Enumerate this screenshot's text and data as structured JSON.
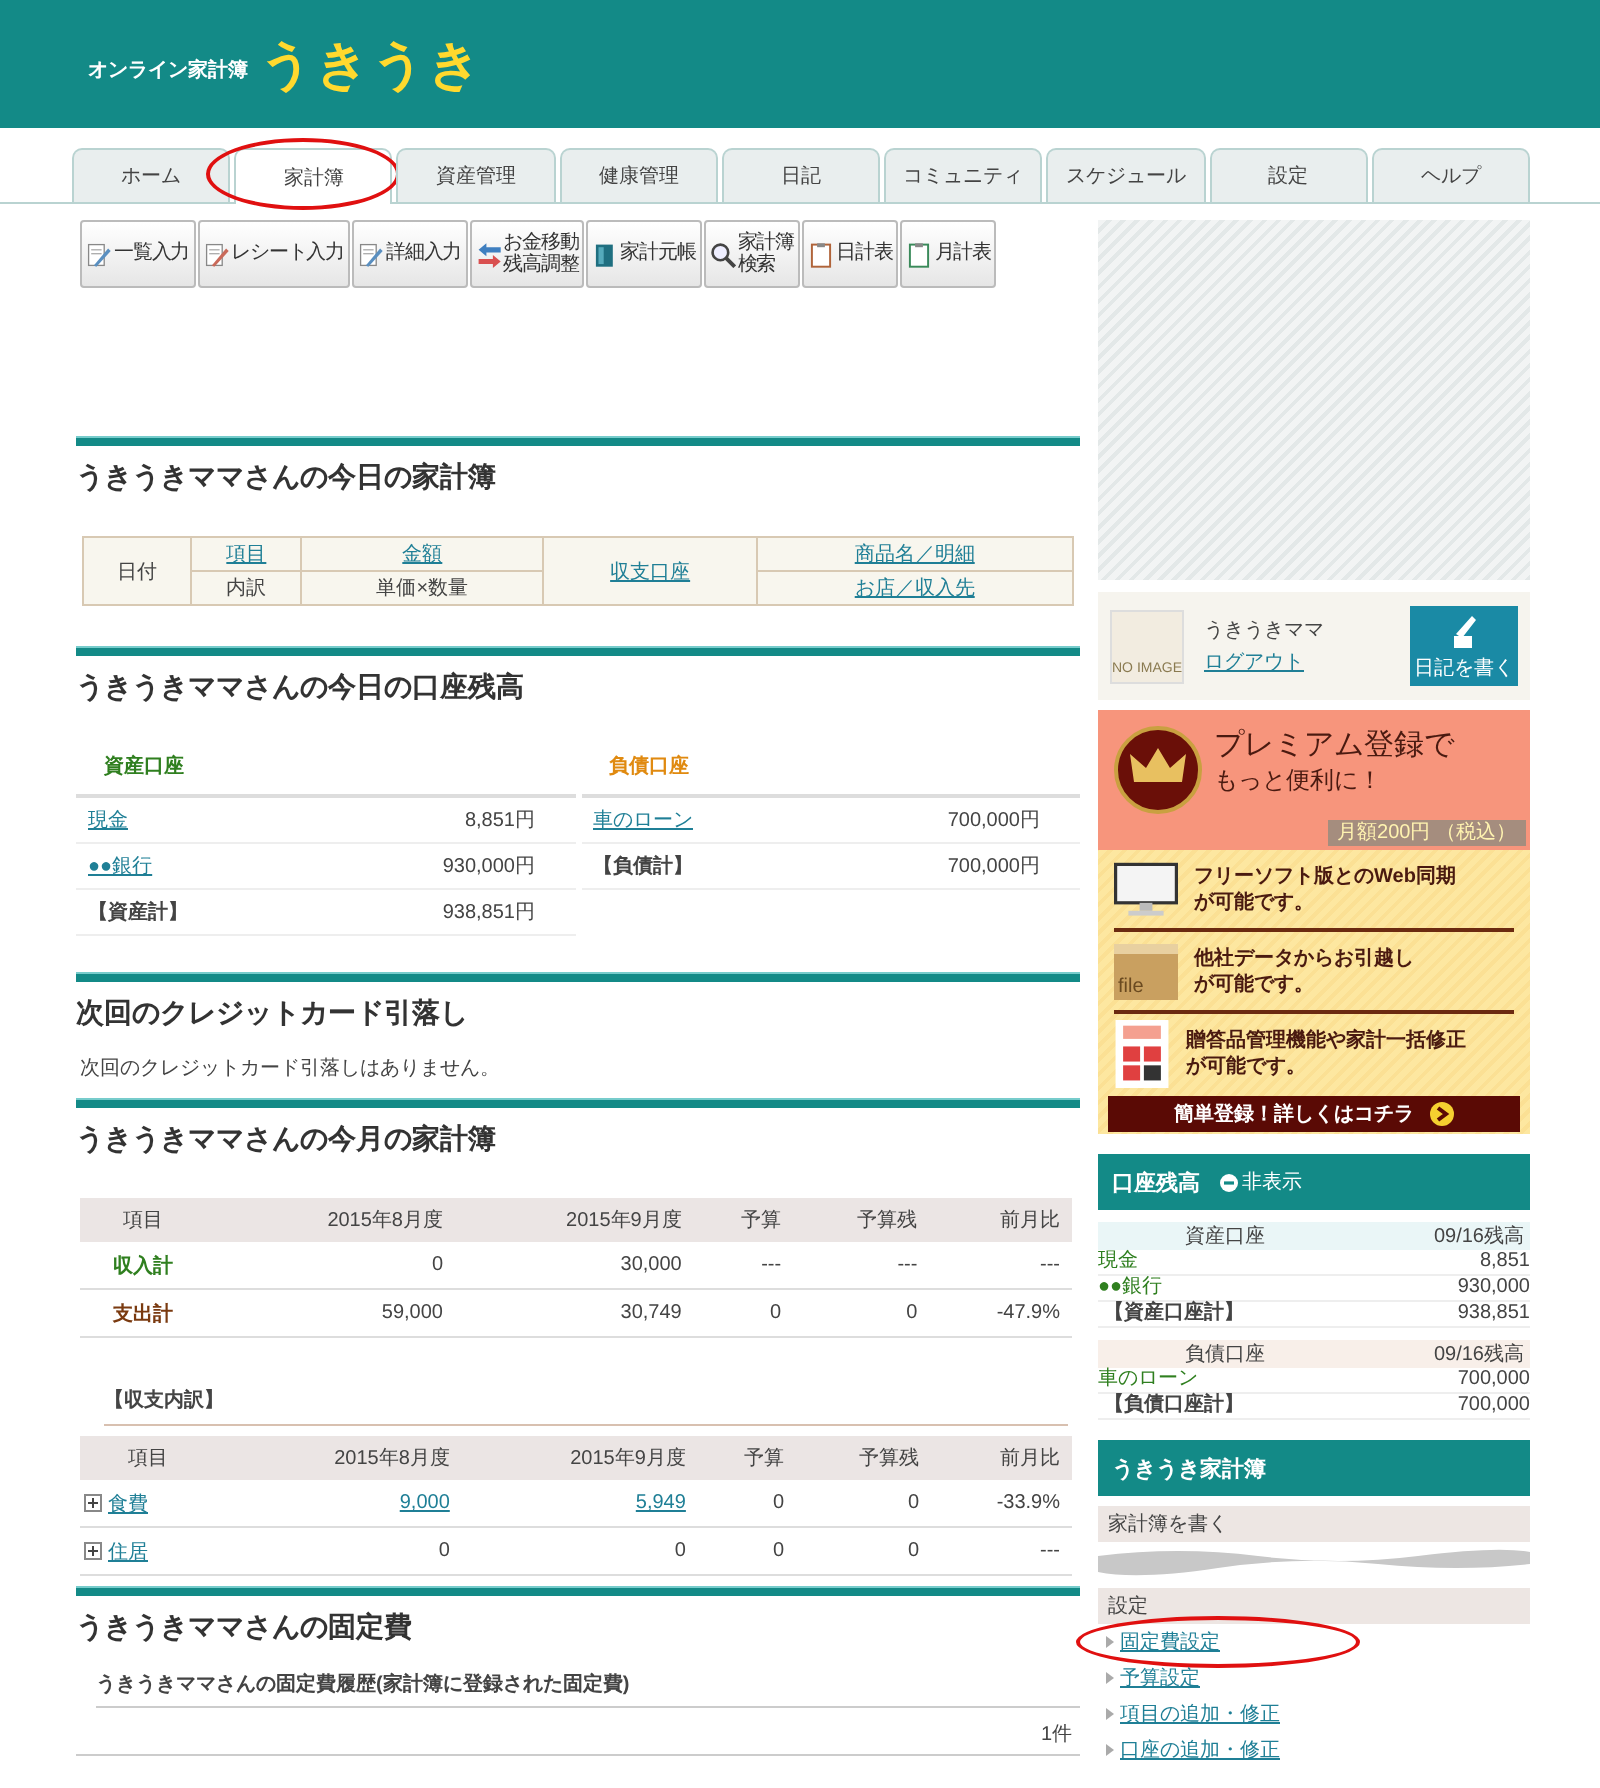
{
  "header": {
    "tagline": "オンライン家計簿",
    "logo": "うきうき"
  },
  "tabs": [
    {
      "label": "ホーム",
      "selected": false,
      "highlighted": false
    },
    {
      "label": "家計簿",
      "selected": true,
      "highlighted": true
    },
    {
      "label": "資産管理",
      "selected": false,
      "highlighted": false
    },
    {
      "label": "健康管理",
      "selected": false,
      "highlighted": false
    },
    {
      "label": "日記",
      "selected": false,
      "highlighted": false
    },
    {
      "label": "コミュニティ",
      "selected": false,
      "highlighted": false
    },
    {
      "label": "スケジュール",
      "selected": false,
      "highlighted": false
    },
    {
      "label": "設定",
      "selected": false,
      "highlighted": false
    },
    {
      "label": "ヘルプ",
      "selected": false,
      "highlighted": false
    }
  ],
  "toolbar": [
    {
      "kind": "list",
      "lines": [
        "一覧入力"
      ]
    },
    {
      "kind": "receipt",
      "lines": [
        "レシート入力"
      ]
    },
    {
      "kind": "detail",
      "lines": [
        "詳細入力"
      ]
    },
    {
      "kind": "transfer",
      "lines": [
        "お金移動",
        "残高調整"
      ]
    },
    {
      "kind": "ledger",
      "lines": [
        "家計元帳"
      ]
    },
    {
      "kind": "search",
      "lines": [
        "家計簿",
        "検索"
      ]
    },
    {
      "kind": "daily",
      "lines": [
        "日計表"
      ]
    },
    {
      "kind": "monthly",
      "lines": [
        "月計表"
      ]
    }
  ],
  "today": {
    "title": "うきうきママさんの今日の家計簿",
    "columns": [
      {
        "cells": [
          {
            "text": "日付",
            "link": false
          }
        ]
      },
      {
        "cells": [
          {
            "text": "項目",
            "link": true
          },
          {
            "text": "内訳",
            "link": false
          }
        ]
      },
      {
        "cells": [
          {
            "text": "金額",
            "link": true
          },
          {
            "text": "単価×数量",
            "link": false
          }
        ]
      },
      {
        "cells": [
          {
            "text": "収支口座",
            "link": true
          }
        ]
      },
      {
        "cells": [
          {
            "text": "商品名／明細",
            "link": true
          },
          {
            "text": "お店／収入先",
            "link": true
          }
        ]
      }
    ]
  },
  "balance": {
    "title": "うきうきママさんの今日の口座残高",
    "groups": [
      {
        "kind": "asset",
        "heading": "資産口座",
        "rows": [
          {
            "kind": "account",
            "name": "現金",
            "amount": "8,851円"
          },
          {
            "kind": "account",
            "name": "●●銀行",
            "amount": "930,000円"
          },
          {
            "kind": "total",
            "name": "【資産計】",
            "amount": "938,851円"
          }
        ]
      },
      {
        "kind": "liability",
        "heading": "負債口座",
        "rows": [
          {
            "kind": "account",
            "name": "車のローン",
            "amount": "700,000円"
          },
          {
            "kind": "total",
            "name": "【負債計】",
            "amount": "700,000円"
          }
        ]
      }
    ]
  },
  "credit": {
    "title": "次回のクレジットカード引落し",
    "message": "次回のクレジットカード引落しはありません。"
  },
  "monthly": {
    "title": "うきうきママさんの今月の家計簿",
    "summary": {
      "columns": [
        "項目",
        "2015年8月度",
        "2015年9月度",
        "予算",
        "予算残",
        "前月比"
      ],
      "rows": [
        {
          "kind": "income",
          "cells": [
            "収入計",
            "0",
            "30,000",
            "---",
            "---",
            "---"
          ]
        },
        {
          "kind": "expense",
          "cells": [
            "支出計",
            "59,000",
            "30,749",
            "0",
            "0",
            "-47.9%"
          ]
        }
      ]
    },
    "breakdown_label": "【収支内訳】",
    "breakdown": {
      "columns": [
        "項目",
        "2015年8月度",
        "2015年9月度",
        "予算",
        "予算残",
        "前月比"
      ],
      "rows": [
        {
          "expanded": false,
          "cells": [
            {
              "text": "食費",
              "link": true
            },
            {
              "text": "9,000",
              "link": true
            },
            {
              "text": "5,949",
              "link": true
            },
            {
              "text": "0",
              "link": false
            },
            {
              "text": "0",
              "link": false
            },
            {
              "text": "-33.9%",
              "link": false
            }
          ]
        },
        {
          "expanded": false,
          "cells": [
            {
              "text": "住居",
              "link": true
            },
            {
              "text": "0",
              "link": false
            },
            {
              "text": "0",
              "link": false
            },
            {
              "text": "0",
              "link": false
            },
            {
              "text": "0",
              "link": false
            },
            {
              "text": "---",
              "link": false
            }
          ]
        }
      ]
    }
  },
  "fixed": {
    "title": "うきうきママさんの固定費",
    "subtitle": "うきうきママさんの固定費履歴(家計簿に登録された固定費)",
    "count": "1件"
  },
  "sidebar": {
    "profile": {
      "avatar_text": "NO IMAGE",
      "name": "うきうきママ",
      "logout": "ログアウト",
      "diary_button": "日記を書く"
    },
    "premium": {
      "title": "プレミアム登録で",
      "subtitle": "もっと便利に！",
      "price": "月額200円",
      "tax": "（税込）",
      "features": [
        {
          "kind": "monitor",
          "lines": [
            "フリーソフト版とのWeb同期",
            "が可能です。"
          ]
        },
        {
          "kind": "folder",
          "icon_text": "file",
          "lines": [
            "他社データからお引越し",
            "が可能です。"
          ]
        },
        {
          "kind": "calculator",
          "lines": [
            "贈答品管理機能や家計一括修正",
            "が可能です。"
          ]
        }
      ],
      "cta": "簡単登録！詳しくはコチラ"
    },
    "balance_widget": {
      "title": "口座残高",
      "toggle": "非表示",
      "tables": [
        {
          "kind": "asset",
          "header": [
            "資産口座",
            "09/16残高"
          ],
          "rows": [
            {
              "kind": "account",
              "name": "現金",
              "amount": "8,851"
            },
            {
              "kind": "account",
              "name": "●●銀行",
              "amount": "930,000"
            },
            {
              "kind": "total",
              "name": "【資産口座計】",
              "amount": "938,851"
            }
          ]
        },
        {
          "kind": "liability",
          "header": [
            "負債口座",
            "09/16残高"
          ],
          "rows": [
            {
              "kind": "account",
              "name": "車のローン",
              "amount": "700,000"
            },
            {
              "kind": "total",
              "name": "【負債口座計】",
              "amount": "700,000"
            }
          ]
        }
      ]
    },
    "menu": {
      "title": "うきうき家計簿",
      "groups": [
        {
          "heading": "家計簿を書く"
        },
        {
          "heading": "設定",
          "items": [
            {
              "label": "固定費設定",
              "highlighted": true
            },
            {
              "label": "予算設定",
              "highlighted": false
            },
            {
              "label": "項目の追加・修正",
              "highlighted": false
            },
            {
              "label": "口座の追加・修正",
              "highlighted": false
            }
          ]
        }
      ]
    }
  }
}
